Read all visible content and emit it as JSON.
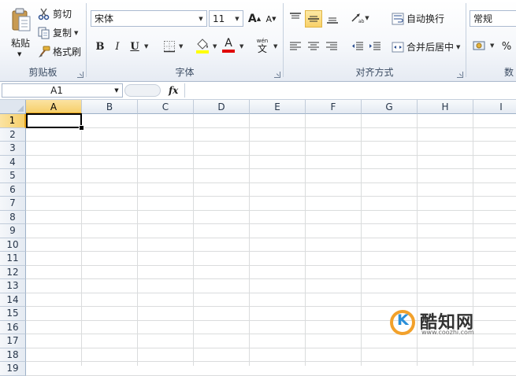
{
  "ribbon": {
    "clipboard": {
      "paste_label": "粘贴",
      "cut_label": "剪切",
      "copy_label": "复制",
      "format_painter_label": "格式刷",
      "group_label": "剪贴板"
    },
    "font": {
      "font_name": "宋体",
      "font_size": "11",
      "bold": "B",
      "italic": "I",
      "underline": "U",
      "font_color_glyph": "A",
      "grow_glyph": "A",
      "shrink_glyph": "A",
      "phonetic_glyph": "wén",
      "group_label": "字体",
      "font_color": "#e00000",
      "fill_color": "#ffff00"
    },
    "alignment": {
      "wrap_text_label": "自动换行",
      "merge_center_label": "合并后居中",
      "group_label": "对齐方式"
    },
    "number": {
      "format_value": "常规",
      "percent": "%",
      "group_label": "数"
    }
  },
  "formula_bar": {
    "name_box": "A1",
    "fx": "fx",
    "formula": ""
  },
  "sheet": {
    "columns": [
      "A",
      "B",
      "C",
      "D",
      "E",
      "F",
      "G",
      "H",
      "I"
    ],
    "rows": [
      "1",
      "2",
      "3",
      "4",
      "5",
      "6",
      "7",
      "8",
      "9",
      "10",
      "11",
      "12",
      "13",
      "14",
      "15",
      "16",
      "17",
      "18",
      "19"
    ],
    "active_cell": "A1"
  },
  "watermark": {
    "title": "酷知网",
    "url": "www.coozhi.com"
  }
}
